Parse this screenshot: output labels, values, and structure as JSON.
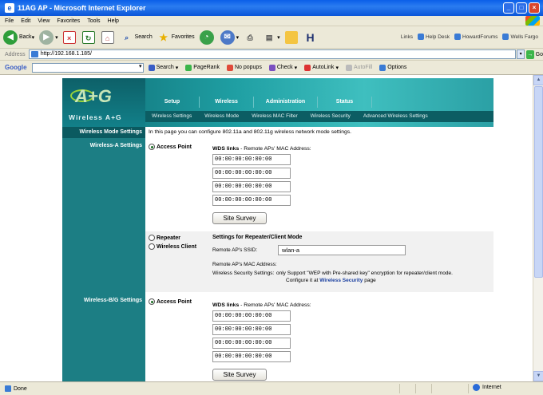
{
  "window": {
    "title": "11AG AP - Microsoft Internet Explorer"
  },
  "menu": [
    "File",
    "Edit",
    "View",
    "Favorites",
    "Tools",
    "Help"
  ],
  "toolbar": {
    "back": "Back",
    "search": "Search",
    "favorites": "Favorites",
    "links_label": "Links",
    "links": [
      "Help Desk",
      "HowardForums",
      "Wells Fargo"
    ]
  },
  "address": {
    "label": "Address",
    "url": "http://192.168.1.185/",
    "go": "Go"
  },
  "google": {
    "logo": "Google",
    "items": [
      "Search",
      "PageRank",
      "No popups",
      "Check",
      "AutoLink",
      "AutoFill",
      "Options"
    ]
  },
  "router": {
    "brand": "Wireless A+G",
    "tabs": [
      "Setup",
      "Wireless",
      "Administration",
      "Status"
    ],
    "subtabs": [
      "Wireless Settings",
      "Wireless Mode",
      "Wireless MAC Filter",
      "Wireless Security",
      "Advanced Wireless Settings"
    ],
    "mode_label": "Wireless Mode Settings",
    "mode_desc": "In this page you can configure 802.11a and 802.11g wireless network mode settings.",
    "a_settings_label": "Wireless-A Settings",
    "bg_settings_label": "Wireless-B/G Settings",
    "access_point": "Access Point",
    "wds_title": "WDS links",
    "wds_desc": " - Remote APs' MAC Address:",
    "macs_a": [
      "00:00:00:00:00:00",
      "00:00:00:00:00:00",
      "00:00:00:00:00:00",
      "00:00:00:00:00:00"
    ],
    "macs_bg": [
      "00:00:00:00:00:00",
      "00:00:00:00:00:00",
      "00:00:00:00:00:00",
      "00:00:00:00:00:00"
    ],
    "site_survey": "Site Survey",
    "repeater": "Repeater",
    "wireless_client": "Wireless Client",
    "repeater_title": "Settings for Repeater/Client Mode",
    "remote_ssid_label": "Remote AP's SSID:",
    "remote_ssid_value": "wlan-a",
    "remote_mac_label": "Remote AP's MAC Address:",
    "security_label": "Wireless Security Settings:",
    "security_text": "only Support \"WEP with Pre-shared key\" encryption for repeater/client mode.",
    "configure_text": "Configure it at",
    "security_link": "Wireless Security",
    "page_suffix": "page"
  },
  "status": {
    "done": "Done",
    "zone": "Internet"
  }
}
